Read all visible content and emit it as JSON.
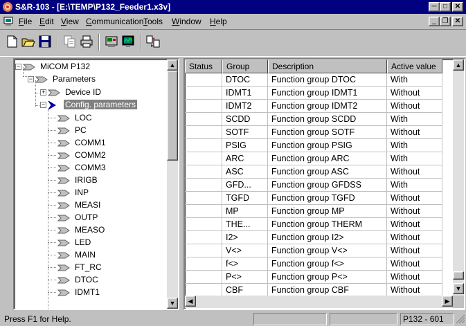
{
  "window": {
    "title": "S&R-103 - [E:\\TEMP\\P132_Feeder1.x3v]"
  },
  "menu": [
    "File",
    "Edit",
    "View",
    "Communication",
    "Tools",
    "Window",
    "Help"
  ],
  "menu_underline": [
    "F",
    "E",
    "V",
    "C",
    "T",
    "W",
    "H"
  ],
  "toolbar": [
    "new-icon",
    "open-icon",
    "save-icon",
    "copy-icon",
    "print-icon",
    "device-icon",
    "monitor-icon",
    "transfer-icon"
  ],
  "tree": {
    "root": "MiCOM P132",
    "parameters": "Parameters",
    "device_id": "Device ID",
    "config": "Config. parameters",
    "items": [
      "LOC",
      "PC",
      "COMM1",
      "COMM2",
      "COMM3",
      "IRIGB",
      "INP",
      "MEASI",
      "OUTP",
      "MEASO",
      "LED",
      "MAIN",
      "FT_RC",
      "DTOC",
      "IDMT1"
    ]
  },
  "grid": {
    "columns": [
      "Status",
      "Group",
      "Description",
      "Active value"
    ],
    "rows": [
      [
        "",
        "DTOC",
        "Function group DTOC",
        "With"
      ],
      [
        "",
        "IDMT1",
        "Function group IDMT1",
        "Without"
      ],
      [
        "",
        "IDMT2",
        "Function group IDMT2",
        "Without"
      ],
      [
        "",
        "SCDD",
        "Function group SCDD",
        "With"
      ],
      [
        "",
        "SOTF",
        "Function group SOTF",
        "Without"
      ],
      [
        "",
        "PSIG",
        "Function group PSIG",
        "With"
      ],
      [
        "",
        "ARC",
        "Function group ARC",
        "With"
      ],
      [
        "",
        "ASC",
        "Function group ASC",
        "Without"
      ],
      [
        "",
        "GFD...",
        "Function group GFDSS",
        "With"
      ],
      [
        "",
        "TGFD",
        "Function group TGFD",
        "Without"
      ],
      [
        "",
        "MP",
        "Function group MP",
        "Without"
      ],
      [
        "",
        "THE...",
        "Function group THERM",
        "Without"
      ],
      [
        "",
        "I2>",
        "Function group I2>",
        "Without"
      ],
      [
        "",
        "V<>",
        "Function group V<>",
        "Without"
      ],
      [
        "",
        "f<>",
        "Function group f<>",
        "Without"
      ],
      [
        "",
        "P<>",
        "Function group P<>",
        "Without"
      ],
      [
        "",
        "CBF",
        "Function group CBF",
        "Without"
      ]
    ]
  },
  "status": {
    "help": "Press F1 for Help.",
    "device": "P132 - 601"
  },
  "colors": {
    "title_bg": "#000080",
    "selection": "#808080",
    "face": "#c0c0c0"
  }
}
